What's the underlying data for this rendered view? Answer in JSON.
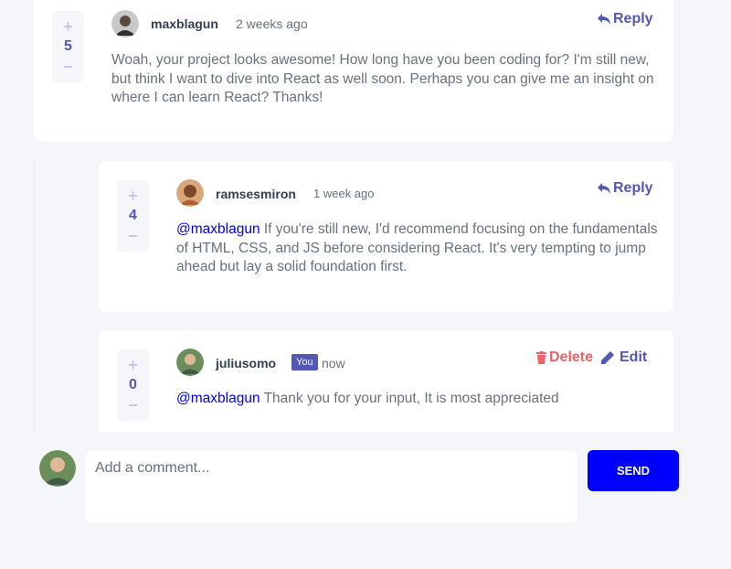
{
  "colors": {
    "accent": "#5357b6",
    "danger": "#ed6368",
    "send": "#0000ff",
    "mention": "#0000ee"
  },
  "comments": [
    {
      "username": "maxblagun",
      "time": "2 weeks ago",
      "score": "5",
      "plus": "+",
      "minus": "−",
      "reply_label": "Reply",
      "text": "Woah, your project looks awesome! How long have you been coding for? I'm still new, but think I want to dive into React as well soon. Perhaps you can give me an insight on where I can learn React? Thanks!"
    },
    {
      "username": "ramsesmiron",
      "time": "1 week ago",
      "score": "4",
      "plus": "+",
      "minus": "−",
      "reply_label": "Reply",
      "mention": "@maxblagun",
      "text": " If you're still new, I'd recommend focusing on the fundamentals of HTML, CSS, and JS before considering React. It's very tempting to jump ahead but lay a solid foundation first."
    },
    {
      "username": "juliusomo",
      "you_badge": "You",
      "time": "now",
      "score": "0",
      "plus": "+",
      "minus": "−",
      "delete_label": "Delete",
      "edit_label": "Edit",
      "mention": "@maxblagun",
      "text": " Thank you for your input, It is most appreciated"
    }
  ],
  "composer": {
    "placeholder": "Add a comment...",
    "send_label": "SEND"
  }
}
